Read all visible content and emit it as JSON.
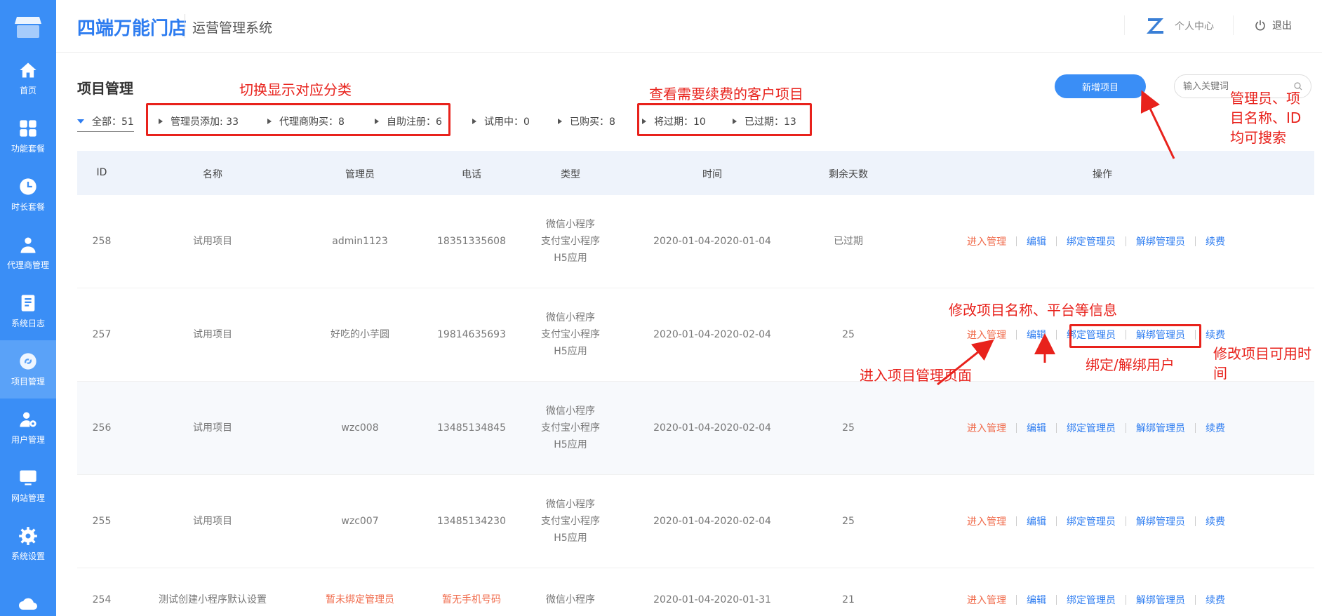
{
  "brand": "四端万能门店",
  "subsystem": "运营管理系统",
  "header": {
    "user_center": "个人中心",
    "logout": "退出"
  },
  "sidebar": {
    "items": [
      {
        "label": "首页",
        "icon": "home-icon"
      },
      {
        "label": "功能套餐",
        "icon": "grid-icon"
      },
      {
        "label": "时长套餐",
        "icon": "clock-icon"
      },
      {
        "label": "代理商管理",
        "icon": "agent-icon"
      },
      {
        "label": "系统日志",
        "icon": "log-icon"
      },
      {
        "label": "项目管理",
        "icon": "project-icon",
        "active": true
      },
      {
        "label": "用户管理",
        "icon": "user-gear-icon"
      },
      {
        "label": "网站管理",
        "icon": "monitor-icon"
      },
      {
        "label": "系统设置",
        "icon": "settings-icon"
      }
    ]
  },
  "page": {
    "title": "项目管理",
    "add_button": "新增项目",
    "search_placeholder": "输入关键词"
  },
  "filters": {
    "all": "全部：51",
    "admin_added": "管理员添加: 33",
    "agent_bought": "代理商购买：8",
    "self_registered": "自助注册：6",
    "trial": "试用中：0",
    "purchased": "已购买：8",
    "expiring": "将过期：10",
    "expired": "已过期：13"
  },
  "table": {
    "columns": [
      "ID",
      "名称",
      "管理员",
      "电话",
      "类型",
      "时间",
      "剩余天数",
      "操作"
    ],
    "rows": [
      {
        "id": "258",
        "name": "试用项目",
        "admin": "admin1123",
        "phone": "18351335608",
        "type1": "微信小程序",
        "type2": "支付宝小程序",
        "type3": "H5应用",
        "time": "2020-01-04-2020-01-04",
        "days": "已过期"
      },
      {
        "id": "257",
        "name": "试用项目",
        "admin": "好吃的小芋圆",
        "phone": "19814635693",
        "type1": "微信小程序",
        "type2": "支付宝小程序",
        "type3": "H5应用",
        "time": "2020-01-04-2020-02-04",
        "days": "25"
      },
      {
        "id": "256",
        "name": "试用项目",
        "admin": "wzc008",
        "phone": "13485134845",
        "type1": "微信小程序",
        "type2": "支付宝小程序",
        "type3": "H5应用",
        "time": "2020-01-04-2020-02-04",
        "days": "25"
      },
      {
        "id": "255",
        "name": "试用项目",
        "admin": "wzc007",
        "phone": "13485134230",
        "type1": "微信小程序",
        "type2": "支付宝小程序",
        "type3": "H5应用",
        "time": "2020-01-04-2020-02-04",
        "days": "25"
      },
      {
        "id": "254",
        "name": "测试创建小程序默认设置",
        "admin": "暂未绑定管理员",
        "phone": "暂无手机号码",
        "type1": "微信小程序",
        "time": "2020-01-04-2020-01-31",
        "days": "21"
      }
    ],
    "ops": {
      "enter": "进入管理",
      "edit": "编辑",
      "bind": "绑定管理员",
      "unbind": "解绑管理员",
      "renew": "续费"
    }
  },
  "annotations": {
    "switch_category": "切换显示对应分类",
    "renewal_check": "查看需要续费的客户项目",
    "search_hint_1": "管理员、项",
    "search_hint_2": "目名称、ID",
    "search_hint_3": "均可搜索",
    "edit_hint": "修改项目名称、平台等信息",
    "enter_hint": "进入项目管理页面",
    "bind_hint": "绑定/解绑用户",
    "renew_hint_1": "修改项目可用时",
    "renew_hint_2": "间"
  },
  "colors": {
    "primary": "#3a8ef6",
    "annotation": "#e8221c",
    "warn": "#f06a4a"
  }
}
